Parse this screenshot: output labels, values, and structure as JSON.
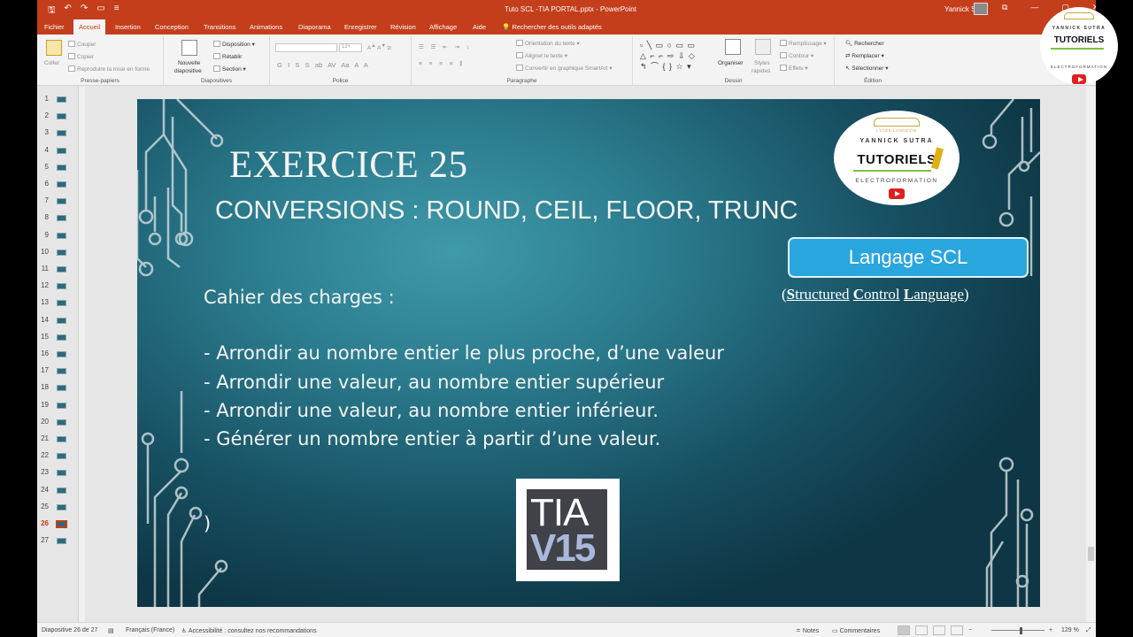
{
  "window": {
    "doc_title": "Tuto SCL -TIA PORTAL.pptx  -  PowerPoint",
    "user": "Yannick S",
    "controls": [
      "—",
      "▢",
      "✕"
    ]
  },
  "tabs": [
    "Fichier",
    "Accueil",
    "Insertion",
    "Conception",
    "Transitions",
    "Animations",
    "Diaporama",
    "Enregistrer",
    "Révision",
    "Affichage",
    "Aide"
  ],
  "search_label": "Rechercher des outils adaptés",
  "ribbon": {
    "clipboard": {
      "paste": "Coller",
      "cut": "Couper",
      "copy": "Copier",
      "format_painter": "Reproduire la mise en forme",
      "label": "Presse-papiers"
    },
    "slides": {
      "new_slide": "Nouvelle",
      "new_slide2": "diapositive",
      "layout": "Disposition",
      "reset": "Rétablir",
      "section": "Section",
      "label": "Diapositives"
    },
    "font": {
      "label": "Police",
      "size": "12+"
    },
    "paragraph": {
      "direction": "Orientation du texte",
      "align": "Aligner le texte",
      "smartart": "Convertir en graphique SmartArt",
      "label": "Paragraphe"
    },
    "drawing": {
      "arrange": "Organiser",
      "quick_styles": "Styles",
      "quick_styles2": "rapides",
      "fill": "Remplissage",
      "outline": "Contour",
      "effects": "Effets",
      "label": "Dessin"
    },
    "editing": {
      "find": "Rechercher",
      "replace": "Remplacer",
      "select": "Sélectionner",
      "label": "Édition"
    }
  },
  "thumbnails": {
    "numbers": [
      "1",
      "2",
      "3",
      "4",
      "5",
      "6",
      "7",
      "8",
      "9",
      "10",
      "11",
      "12",
      "13",
      "14",
      "15",
      "16",
      "17",
      "18",
      "19",
      "20",
      "21",
      "22",
      "23",
      "24",
      "25",
      "26",
      "27"
    ],
    "active": "26"
  },
  "slide": {
    "title": "EXERCICE 25",
    "subtitle": "CONVERSIONS : ROUND, CEIL, FLOOR, TRUNC",
    "cahier": "Cahier des charges :",
    "items": [
      "-    Arrondir au nombre entier le plus proche, d’une valeur",
      "-    Arrondir une valeur, au nombre entier supérieur",
      "-    Arrondir une valeur, au nombre entier inférieur.",
      "- Générer un nombre entier à partir d’une valeur."
    ],
    "paren": ")",
    "lang_box": "Langage SCL",
    "scl_open": "(",
    "scl_S": "S",
    "scl_tructured": "tructured",
    "scl_C": "C",
    "scl_ontrol": "ontrol",
    "scl_L": "L",
    "scl_anguage": "anguage",
    "scl_close": ")",
    "logo": {
      "name": "YANNICK SUTRA",
      "main": "TUTORIELS",
      "sub": "ELECTROFORMATION",
      "school": "LYCÉE LANGEVIN"
    },
    "tia_line1": "TIA",
    "tia_line2": "V15"
  },
  "statusbar": {
    "slide_pos": "Diapositive 26 de 27",
    "language": "Français (France)",
    "accessibility": "Accessibilité : consultez nos recommandations",
    "notes": "Notes",
    "comments": "Commentaires",
    "zoom": "129 %"
  },
  "colors": {
    "accent": "#c43e1c",
    "slide_dark": "#0e3644",
    "slide_light": "#3f9aaa",
    "lang_box": "#2aa6df"
  }
}
